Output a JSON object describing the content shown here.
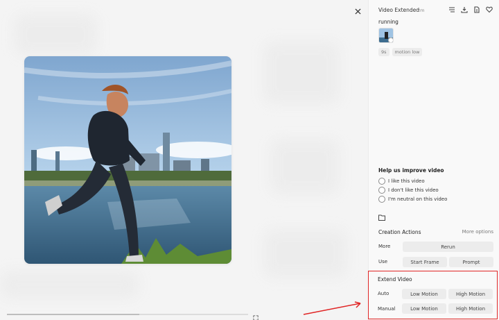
{
  "header": {
    "title": "Video Extended",
    "time": "2m"
  },
  "prompt": "running",
  "tags": [
    "9s",
    "motion low"
  ],
  "feedback": {
    "title": "Help us improve video",
    "options": [
      "I like this video",
      "I don't like this video",
      "I'm neutral on this video"
    ]
  },
  "creation_actions": {
    "title": "Creation Actions",
    "more_options": "More options",
    "rows": [
      {
        "label": "More",
        "buttons": [
          "Rerun"
        ]
      },
      {
        "label": "Use",
        "buttons": [
          "Start Frame",
          "Prompt"
        ]
      }
    ]
  },
  "extend_video": {
    "title": "Extend Video",
    "rows": [
      {
        "label": "Auto",
        "buttons": [
          "Low Motion",
          "High Motion"
        ]
      },
      {
        "label": "Manual",
        "buttons": [
          "Low Motion",
          "High Motion"
        ]
      }
    ]
  },
  "player": {
    "progress": 0.55
  },
  "colors": {
    "highlight": "#e02424",
    "sky": "#9fc3e3",
    "water": "#3e6d8f"
  }
}
